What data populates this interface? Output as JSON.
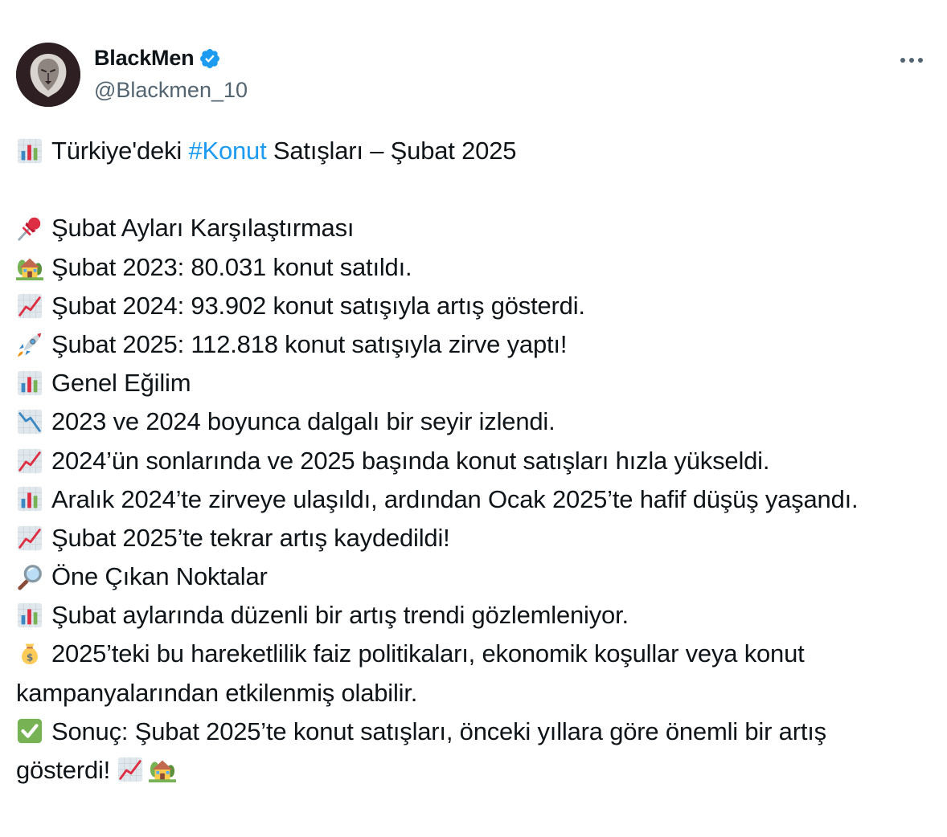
{
  "author": {
    "display_name": "BlackMen",
    "handle": "@Blackmen_10",
    "verified": true,
    "avatar_icon": "lion-logo"
  },
  "colors": {
    "text": "#0f1419",
    "secondary": "#536471",
    "link": "#1d9bf0",
    "verified_badge": "#1d9bf0",
    "avatar_bg": "#2d1f22"
  },
  "tweet": {
    "title": {
      "icon": "bar-chart-icon",
      "prefix": "Türkiye'deki ",
      "hashtag": "#Konut",
      "suffix": " Satışları – Şubat 2025"
    },
    "lines": [
      {
        "icon": "pushpin-icon",
        "text": "Şubat Ayları Karşılaştırması"
      },
      {
        "icon": "house-garden-icon",
        "text": "Şubat 2023: 80.031 konut satıldı."
      },
      {
        "icon": "chart-increasing-icon",
        "text": "Şubat 2024: 93.902 konut satışıyla artış gösterdi."
      },
      {
        "icon": "rocket-icon",
        "text": "Şubat 2025: 112.818 konut satışıyla zirve yaptı!"
      },
      {
        "icon": "bar-chart-icon",
        "text": "Genel Eğilim"
      },
      {
        "icon": "chart-decreasing-icon",
        "text": "2023 ve 2024 boyunca dalgalı bir seyir izlendi."
      },
      {
        "icon": "chart-increasing-icon",
        "text": "2024’ün sonlarında ve 2025 başında konut satışları hızla yükseldi."
      },
      {
        "icon": "bar-chart-icon",
        "text": "Aralık 2024’te zirveye ulaşıldı, ardından Ocak 2025’te hafif düşüş yaşandı."
      },
      {
        "icon": "chart-increasing-icon",
        "text": "Şubat 2025’te tekrar artış kaydedildi!"
      },
      {
        "icon": "magnifying-glass-icon",
        "text": "Öne Çıkan Noktalar"
      },
      {
        "icon": "bar-chart-icon",
        "text": "Şubat aylarında düzenli bir artış trendi gözlemleniyor."
      },
      {
        "icon": "money-bag-icon",
        "text": "2025’teki bu hareketlilik faiz politikaları, ekonomik koşullar veya konut kampanyalarından etkilenmiş olabilir."
      },
      {
        "icon": "check-mark-icon",
        "text": "Sonuç: Şubat 2025’te konut satışları, önceki yıllara göre önemli bir artış gösterdi!"
      }
    ]
  }
}
